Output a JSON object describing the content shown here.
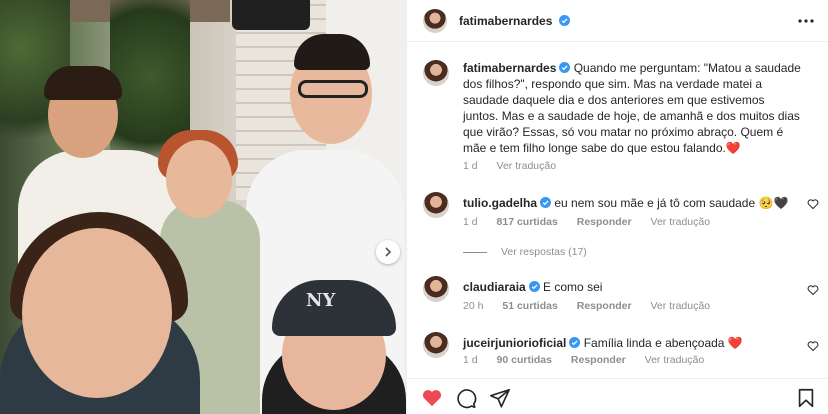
{
  "post": {
    "username": "fatimabernardes",
    "more_icon": "more-options-icon"
  },
  "caption": {
    "username": "fatimabernardes",
    "text": "Quando me perguntam: \"Matou a saudade dos filhos?\", respondo que sim. Mas na verdade matei a saudade daquele dia e dos anteriores em que estivemos juntos. Mas e a saudade de hoje, de amanhã e dos muitos dias que virão? Essas, só vou matar no próximo abraço. Quem é mãe e tem filho longe sabe do que estou falando.",
    "emoji": "❤️",
    "time": "1 d",
    "translate": "Ver tradução"
  },
  "comments": [
    {
      "username": "tulio.gadelha",
      "text": "eu nem sou mãe e já tô com saudade",
      "emoji": "🥺🖤",
      "time": "1 d",
      "likes": "817 curtidas",
      "reply": "Responder",
      "translate": "Ver tradução",
      "view_replies": "Ver respostas (17)"
    },
    {
      "username": "claudiaraia",
      "text": "E como sei",
      "emoji": "",
      "time": "20 h",
      "likes": "51 curtidas",
      "reply": "Responder",
      "translate": "Ver tradução"
    },
    {
      "username": "juceirjuniorioficial",
      "text": "Família linda e abençoada",
      "emoji": "❤️",
      "time": "1 d",
      "likes": "90 curtidas",
      "reply": "Responder",
      "translate": "Ver tradução"
    }
  ],
  "photo": {
    "cap_logo": "NY"
  },
  "colors": {
    "verified": "#3897f0",
    "liked_heart": "#ed4956",
    "muted_text": "#8e8e8e"
  },
  "icons": {
    "like": "heart-icon",
    "comment": "comment-icon",
    "share": "share-icon",
    "save": "bookmark-icon",
    "carousel_next": "chevron-right-icon"
  }
}
